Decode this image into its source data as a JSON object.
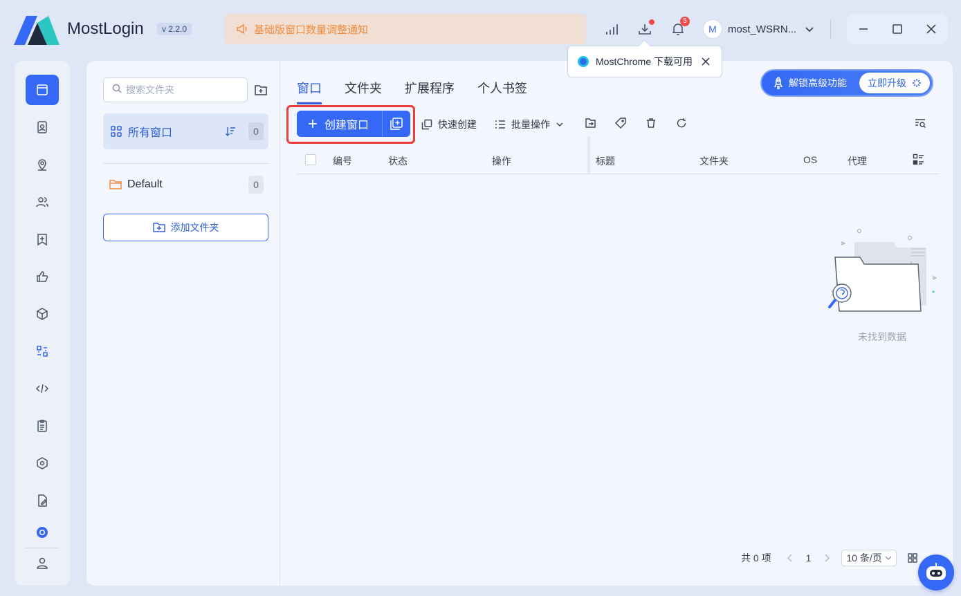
{
  "app": {
    "name": "MostLogin",
    "version": "v 2.2.0"
  },
  "notice": {
    "text": "基础版窗口数量调整通知"
  },
  "header": {
    "notifications_count": "5",
    "user": {
      "avatar_letter": "M",
      "name": "most_WSRN..."
    }
  },
  "tooltip": {
    "text": "MostChrome 下载可用"
  },
  "nav": {
    "items": [
      "browser-window-icon",
      "profile-card-icon",
      "location-pin-icon",
      "team-users-icon",
      "bookmark-add-icon",
      "thumbs-up-icon",
      "cube-icon",
      "automation-icon",
      "code-icon",
      "clipboard-icon",
      "hexagon-settings-icon",
      "document-edit-icon",
      "mostchrome-icon",
      "user-account-icon"
    ]
  },
  "folders": {
    "search_placeholder": "搜索文件夹",
    "all_label": "所有窗口",
    "all_count": "0",
    "items": [
      {
        "name": "Default",
        "count": "0"
      }
    ],
    "add_label": "添加文件夹"
  },
  "tabs": [
    "窗口",
    "文件夹",
    "扩展程序",
    "个人书签"
  ],
  "upgrade": {
    "unlock_label": "解锁高级功能",
    "button_label": "立即升级"
  },
  "toolbar": {
    "create_label": "创建窗口",
    "quick_create_label": "快速创建",
    "batch_label": "批量操作"
  },
  "table": {
    "columns": [
      "编号",
      "状态",
      "操作",
      "标题",
      "文件夹",
      "OS",
      "代理"
    ],
    "empty_text": "未找到数据"
  },
  "pagination": {
    "total": "共 0 项",
    "page": "1",
    "page_size": "10 条/页"
  },
  "colors": {
    "accent": "#3468f5",
    "notice": "#f08a3c",
    "highlight": "#ec3c3c"
  }
}
